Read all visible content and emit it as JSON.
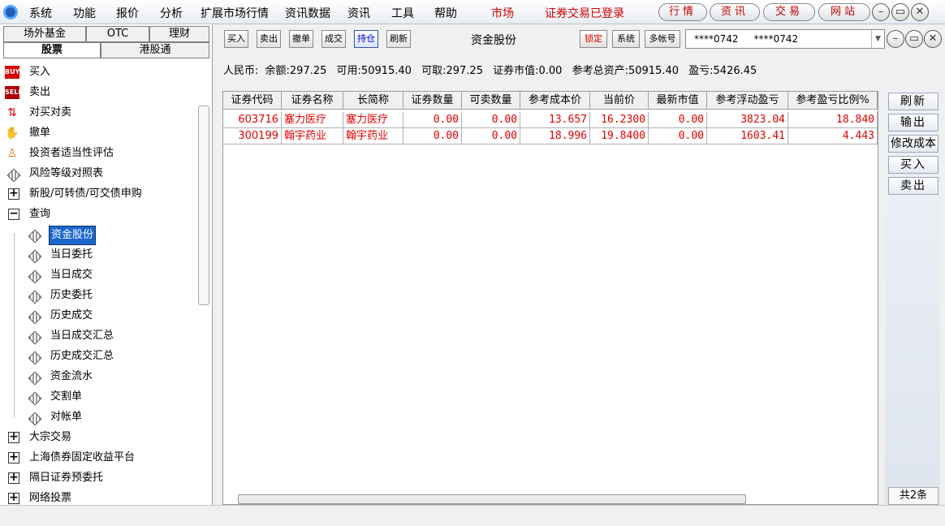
{
  "menubar": {
    "items": [
      "系统",
      "功能",
      "报价",
      "分析",
      "扩展市场行情",
      "资讯数据",
      "资讯",
      "工具",
      "帮助"
    ],
    "market": "市场",
    "login_status": "证券交易已登录",
    "pills": [
      "行情",
      "资讯",
      "交易",
      "网站"
    ],
    "window_controls": [
      "minimize-icon",
      "restore-icon",
      "close-icon"
    ]
  },
  "left": {
    "tabs_row1": [
      "场外基金",
      "OTC",
      "理财"
    ],
    "tabs_row2": [
      "股票",
      "港股通"
    ],
    "active_tab": "股票",
    "tree": {
      "buy": "买入",
      "sell": "卖出",
      "pair": "对买对卖",
      "cancel": "撤单",
      "assess": "投资者适当性评估",
      "risk": "风险等级对照表",
      "ipo": "新股/可转债/可交债申购",
      "query": "查询",
      "query_children": [
        "资金股份",
        "当日委托",
        "当日成交",
        "历史委托",
        "历史成交",
        "当日成交汇总",
        "历史成交汇总",
        "资金流水",
        "交割单",
        "对帐单"
      ],
      "selected": "资金股份",
      "block": "大宗交易",
      "bond": "上海债券固定收益平台",
      "preorder": "隔日证券预委托",
      "vote": "网络投票"
    }
  },
  "toolbar": {
    "buttons": [
      "买入",
      "卖出",
      "撤单",
      "成交",
      "持仓",
      "刷新"
    ],
    "active": "持仓",
    "title": "资金股份",
    "lock": "锁定",
    "system": "系统",
    "multi": "多帐号",
    "account": "****0742     ****0742"
  },
  "info": {
    "currency": "人民币:",
    "balance": "余额:297.25",
    "available": "可用:50915.40",
    "withdrawable": "可取:297.25",
    "market_value": "证券市值:0.00",
    "total_assets": "参考总资产:50915.40",
    "profit": "盈亏:5426.45"
  },
  "table": {
    "columns": [
      "证券代码",
      "证券名称",
      "长简称",
      "证券数量",
      "可卖数量",
      "参考成本价",
      "当前价",
      "最新市值",
      "参考浮动盈亏",
      "参考盈亏比例%"
    ],
    "rows": [
      [
        "603716",
        "塞力医疗",
        "塞力医疗",
        "0.00",
        "0.00",
        "13.657",
        "16.2300",
        "0.00",
        "3823.04",
        "18.840"
      ],
      [
        "300199",
        "翰宇药业",
        "翰宇药业",
        "0.00",
        "0.00",
        "18.996",
        "19.8400",
        "0.00",
        "1603.41",
        "4.443"
      ]
    ]
  },
  "side_buttons": [
    "刷新",
    "输出",
    "修改成本",
    "买入",
    "卖出"
  ],
  "count": "共2条",
  "colors": {
    "accent": "#d40000",
    "select": "#1a66cc",
    "data_text": "#e00000"
  }
}
